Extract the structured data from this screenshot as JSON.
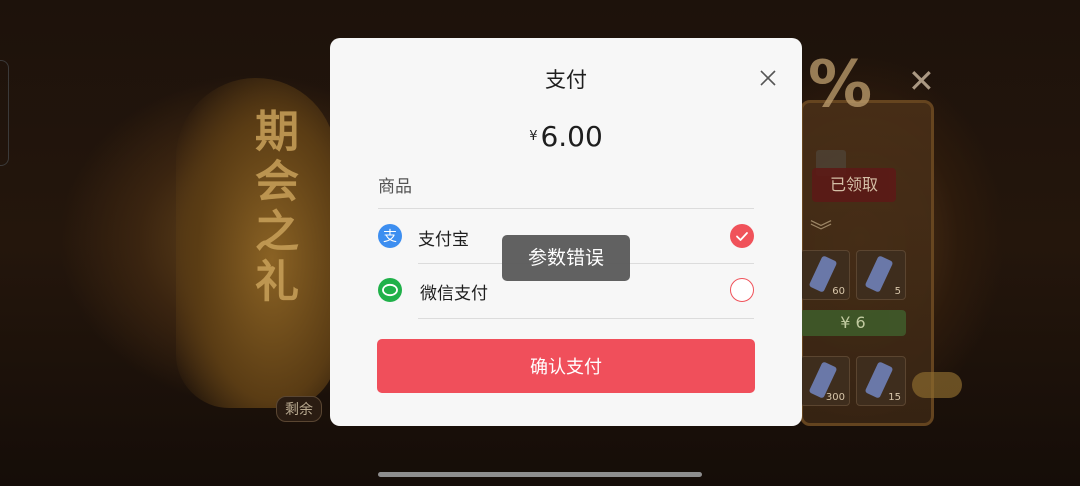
{
  "background": {
    "gift_title": "期会之礼",
    "remaining_label": "剩余",
    "percent_text": "%",
    "claim_label": "已领取",
    "price_label": "¥ 6",
    "item_counts_top": [
      "60",
      "5"
    ],
    "item_counts_bottom": [
      "300",
      "15"
    ]
  },
  "dialog": {
    "title": "支付",
    "currency_symbol": "¥",
    "amount": "6.00",
    "product_label": "商品",
    "payment_methods": [
      {
        "name": "支付宝",
        "icon": "alipay-icon",
        "selected": true
      },
      {
        "name": "微信支付",
        "icon": "wechat-icon",
        "selected": false
      }
    ],
    "confirm_label": "确认支付"
  },
  "toast": {
    "message": "参数错误"
  },
  "colors": {
    "accent": "#f04f5b",
    "alipay": "#3d8ef0",
    "wechat": "#20b14a"
  }
}
